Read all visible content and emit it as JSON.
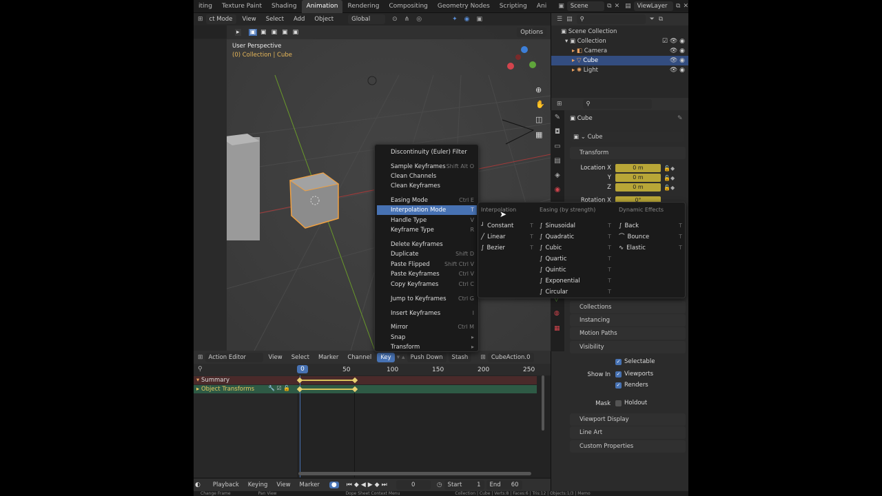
{
  "workspace_tabs": [
    "iting",
    "Texture Paint",
    "Shading",
    "Animation",
    "Rendering",
    "Compositing",
    "Geometry Nodes",
    "Scripting",
    "Ani"
  ],
  "scene": {
    "name": "Scene",
    "view_layer": "ViewLayer"
  },
  "viewport": {
    "mode": "ct Mode",
    "menus": [
      "View",
      "Select",
      "Add",
      "Object"
    ],
    "orientation": "Global",
    "options": "Options",
    "title": "User Perspective",
    "collection_label": "(0) Collection | Cube"
  },
  "context_menu": {
    "items": [
      {
        "label": "Discontinuity (Euler) Filter",
        "shortcut": ""
      },
      {
        "label": "Sample Keyframes",
        "shortcut": "Shift Alt O"
      },
      {
        "label": "Clean Channels",
        "shortcut": ""
      },
      {
        "label": "Clean Keyframes",
        "shortcut": ""
      },
      {
        "label": "Easing Mode",
        "shortcut": "Ctrl E"
      },
      {
        "label": "Interpolation Mode",
        "shortcut": "T"
      },
      {
        "label": "Handle Type",
        "shortcut": "V"
      },
      {
        "label": "Keyframe Type",
        "shortcut": "R"
      },
      {
        "label": "Delete Keyframes",
        "shortcut": ""
      },
      {
        "label": "Duplicate",
        "shortcut": "Shift D"
      },
      {
        "label": "Paste Flipped",
        "shortcut": "Shift Ctrl V"
      },
      {
        "label": "Paste Keyframes",
        "shortcut": "Ctrl V"
      },
      {
        "label": "Copy Keyframes",
        "shortcut": "Ctrl C"
      },
      {
        "label": "Jump to Keyframes",
        "shortcut": "Ctrl G"
      },
      {
        "label": "Insert Keyframes",
        "shortcut": "I"
      },
      {
        "label": "Mirror",
        "shortcut": "Ctrl M"
      },
      {
        "label": "Snap",
        "shortcut": ""
      },
      {
        "label": "Transform",
        "shortcut": ""
      }
    ]
  },
  "submenu": {
    "headers": [
      "Interpolation",
      "Easing (by strength)",
      "Dynamic Effects"
    ],
    "interpolation": [
      "Constant",
      "Linear",
      "Bezier"
    ],
    "easing": [
      "Sinusoidal",
      "Quadratic",
      "Cubic",
      "Quartic",
      "Quintic",
      "Exponential",
      "Circular"
    ],
    "dynamic": [
      "Back",
      "Bounce",
      "Elastic"
    ],
    "hotkey": "T"
  },
  "outliner": {
    "root": "Scene Collection",
    "collection": "Collection",
    "items": [
      "Camera",
      "Cube",
      "Light"
    ]
  },
  "properties": {
    "object_name": "Cube",
    "data_name": "Cube",
    "transform": "Transform",
    "loc_labels": [
      "Location X",
      "Y",
      "Z"
    ],
    "loc_values": [
      "0 m",
      "0 m",
      "0 m"
    ],
    "rotation_label": "Rotation X",
    "rotation_value": "0°",
    "panels": [
      "Collections",
      "Instancing",
      "Motion Paths",
      "Visibility"
    ],
    "selectable": "Selectable",
    "show_in": "Show In",
    "viewports": "Viewports",
    "renders": "Renders",
    "mask": "Mask",
    "holdout": "Holdout",
    "panels2": [
      "Viewport Display",
      "Line Art",
      "Custom Properties"
    ]
  },
  "action_editor": {
    "mode": "Action Editor",
    "menus": [
      "View",
      "Select",
      "Marker",
      "Channel",
      "Key"
    ],
    "push_down": "Push Down",
    "stash": "Stash",
    "action": "CubeAction.0",
    "frames": [
      "0",
      "50",
      "100",
      "150",
      "200",
      "250"
    ],
    "channels": [
      "Summary",
      "Object Transforms"
    ]
  },
  "playback": {
    "menus": [
      "Playback",
      "Keying",
      "View",
      "Marker"
    ],
    "frame": "0",
    "start_label": "Start",
    "start": "1",
    "end_label": "End",
    "end": "60"
  },
  "status": {
    "left": "Change Frame",
    "mid": "Pan View",
    "right": "Dope Sheet Context Menu",
    "stats": "Collection | Cube | Verts:8 | Faces:6 | Tris:12 | Objects:1/3 | Memo"
  }
}
